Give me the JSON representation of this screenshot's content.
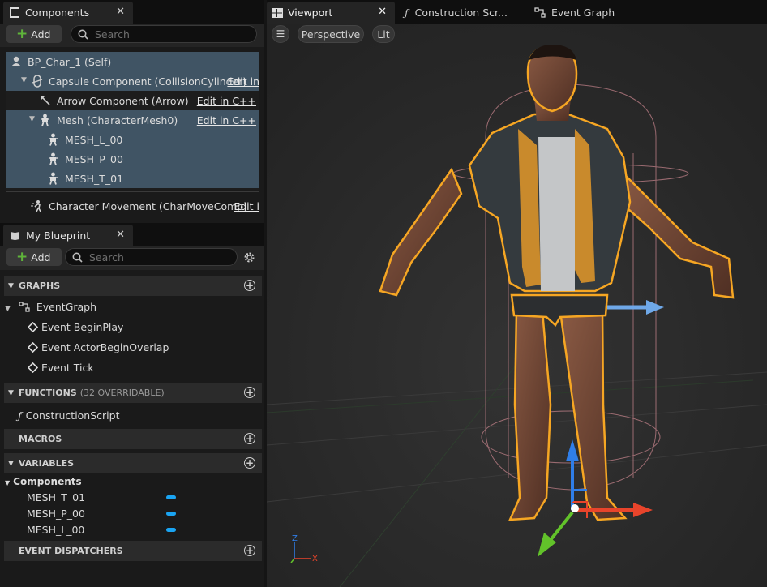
{
  "components_panel": {
    "tab_title": "Components",
    "add_label": "Add",
    "search_placeholder": "Search",
    "rows": [
      {
        "label": "BP_Char_1 (Self)",
        "edit": ""
      },
      {
        "label": "Capsule Component (CollisionCylinder)",
        "edit": "Edit in"
      },
      {
        "label": "Arrow Component (Arrow)",
        "edit": "Edit in C++"
      },
      {
        "label": "Mesh (CharacterMesh0)",
        "edit": "Edit in C++"
      },
      {
        "label": "MESH_L_00",
        "edit": ""
      },
      {
        "label": "MESH_P_00",
        "edit": ""
      },
      {
        "label": "MESH_T_01",
        "edit": ""
      },
      {
        "label": "Character Movement (CharMoveComp)",
        "edit": "Edit i"
      }
    ]
  },
  "blueprint_panel": {
    "tab_title": "My Blueprint",
    "add_label": "Add",
    "search_placeholder": "Search",
    "graphs_header": "GRAPHS",
    "event_graph": "EventGraph",
    "events": [
      "Event BeginPlay",
      "Event ActorBeginOverlap",
      "Event Tick"
    ],
    "functions_header": "FUNCTIONS",
    "functions_note": "(32 OVERRIDABLE)",
    "construction_script": "ConstructionScript",
    "macros_header": "MACROS",
    "variables_header": "VARIABLES",
    "components_category": "Components",
    "variables": [
      "MESH_T_01",
      "MESH_P_00",
      "MESH_L_00"
    ],
    "variable_color": "#1aa4f2",
    "dispatchers_header": "EVENT DISPATCHERS"
  },
  "viewport": {
    "tabs": [
      "Viewport",
      "Construction Scr...",
      "Event Graph"
    ],
    "view_mode": "Perspective",
    "lighting_mode": "Lit",
    "axis_x": "X",
    "axis_z": "Z"
  },
  "colors": {
    "selection": "#405464",
    "outline": "#f6a623",
    "gizmo_x": "#e8442b",
    "gizmo_y": "#62c22a",
    "gizmo_z": "#2f7ee8"
  }
}
